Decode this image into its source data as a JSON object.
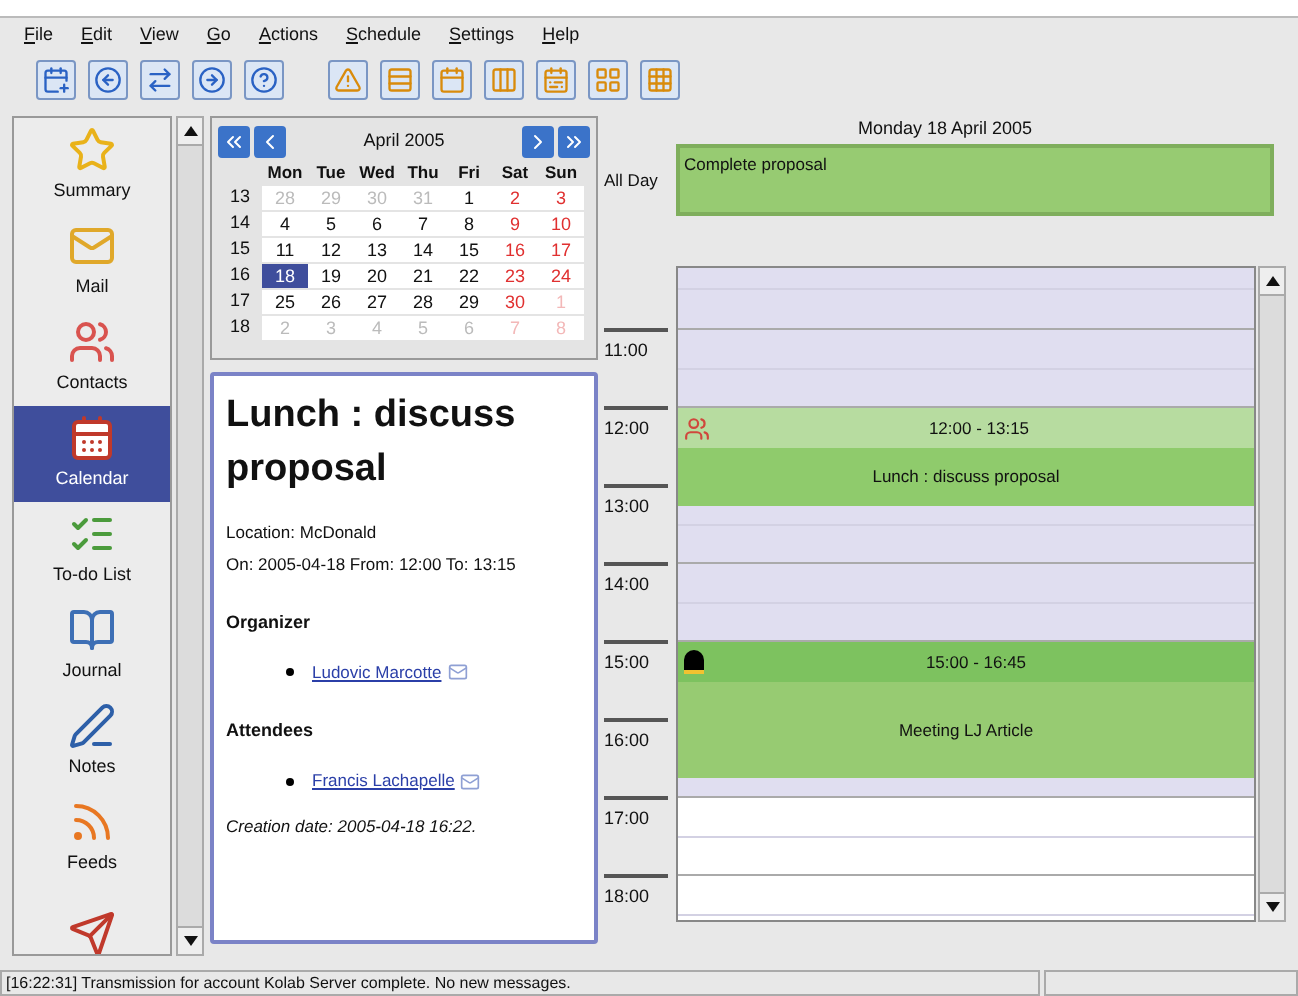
{
  "menu": [
    "File",
    "Edit",
    "View",
    "Go",
    "Actions",
    "Schedule",
    "Settings",
    "Help"
  ],
  "sidebar": {
    "items": [
      {
        "label": "Summary",
        "selected": false
      },
      {
        "label": "Mail",
        "selected": false
      },
      {
        "label": "Contacts",
        "selected": false
      },
      {
        "label": "Calendar",
        "selected": true
      },
      {
        "label": "To-do List",
        "selected": false
      },
      {
        "label": "Journal",
        "selected": false
      },
      {
        "label": "Notes",
        "selected": false
      },
      {
        "label": "Feeds",
        "selected": false
      },
      {
        "selected": false
      }
    ]
  },
  "mini_calendar": {
    "month": "April 2005",
    "weekdays": [
      "Mon",
      "Tue",
      "Wed",
      "Thu",
      "Fri",
      "Sat",
      "Sun"
    ],
    "weeks": [
      {
        "number": "13",
        "days": [
          {
            "day": "28",
            "other_month": true,
            "selected": false
          },
          {
            "day": "29",
            "other_month": true,
            "selected": false
          },
          {
            "day": "30",
            "other_month": true,
            "selected": false
          },
          {
            "day": "31",
            "other_month": true,
            "selected": false
          },
          {
            "day": "1",
            "other_month": false,
            "selected": false
          },
          {
            "day": "2",
            "other_month": false,
            "selected": false
          },
          {
            "day": "3",
            "other_month": false,
            "selected": false
          }
        ]
      },
      {
        "number": "14",
        "days": [
          {
            "day": "4",
            "other_month": false,
            "selected": false
          },
          {
            "day": "5",
            "other_month": false,
            "selected": false
          },
          {
            "day": "6",
            "other_month": false,
            "selected": false
          },
          {
            "day": "7",
            "other_month": false,
            "selected": false
          },
          {
            "day": "8",
            "other_month": false,
            "selected": false
          },
          {
            "day": "9",
            "other_month": false,
            "selected": false
          },
          {
            "day": "10",
            "other_month": false,
            "selected": false
          }
        ]
      },
      {
        "number": "15",
        "days": [
          {
            "day": "11",
            "other_month": false,
            "selected": false
          },
          {
            "day": "12",
            "other_month": false,
            "selected": false
          },
          {
            "day": "13",
            "other_month": false,
            "selected": false
          },
          {
            "day": "14",
            "other_month": false,
            "selected": false
          },
          {
            "day": "15",
            "other_month": false,
            "selected": false
          },
          {
            "day": "16",
            "other_month": false,
            "selected": false
          },
          {
            "day": "17",
            "other_month": false,
            "selected": false
          }
        ]
      },
      {
        "number": "16",
        "days": [
          {
            "day": "18",
            "other_month": false,
            "selected": true
          },
          {
            "day": "19",
            "other_month": false,
            "selected": false
          },
          {
            "day": "20",
            "other_month": false,
            "selected": false
          },
          {
            "day": "21",
            "other_month": false,
            "selected": false
          },
          {
            "day": "22",
            "other_month": false,
            "selected": false
          },
          {
            "day": "23",
            "other_month": false,
            "selected": false
          },
          {
            "day": "24",
            "other_month": false,
            "selected": false
          }
        ]
      },
      {
        "number": "17",
        "days": [
          {
            "day": "25",
            "other_month": false,
            "selected": false
          },
          {
            "day": "26",
            "other_month": false,
            "selected": false
          },
          {
            "day": "27",
            "other_month": false,
            "selected": false
          },
          {
            "day": "28",
            "other_month": false,
            "selected": false
          },
          {
            "day": "29",
            "other_month": false,
            "selected": false
          },
          {
            "day": "30",
            "other_month": false,
            "selected": false
          },
          {
            "day": "1",
            "other_month": true,
            "selected": false
          }
        ]
      },
      {
        "number": "18",
        "days": [
          {
            "day": "2",
            "other_month": true,
            "selected": false
          },
          {
            "day": "3",
            "other_month": true,
            "selected": false
          },
          {
            "day": "4",
            "other_month": true,
            "selected": false
          },
          {
            "day": "5",
            "other_month": true,
            "selected": false
          },
          {
            "day": "6",
            "other_month": true,
            "selected": false
          },
          {
            "day": "7",
            "other_month": true,
            "selected": false
          },
          {
            "day": "8",
            "other_month": true,
            "selected": false
          }
        ]
      }
    ]
  },
  "event_details": {
    "title": "Lunch : discuss proposal",
    "location": "Location: McDonald",
    "when": "On: 2005-04-18 From: 12:00 To: 13:15",
    "organizer_heading": "Organizer",
    "organizer": "Ludovic Marcotte",
    "attendees_heading": "Attendees",
    "attendees": [
      "Francis Lachapelle"
    ],
    "creation": "Creation date: 2005-04-18 16:22."
  },
  "day_view": {
    "date": "Monday 18 April 2005",
    "all_day_label": "All Day",
    "all_day_event": "Complete proposal",
    "hours": [
      {
        "label": "11:00",
        "working": true
      },
      {
        "label": "12:00"
      },
      {
        "label": "13:00",
        "working": true
      },
      {
        "label": "14:00",
        "working": true
      },
      {
        "label": "15:00"
      },
      {
        "label": "16:00",
        "working": true
      },
      {
        "label": "17:00",
        "working": false
      },
      {
        "label": "18:00",
        "working": false
      }
    ],
    "events": [
      {
        "kind": "group",
        "time": "12:00 - 13:15",
        "title": "Lunch : discuss proposal"
      },
      {
        "kind": "personal",
        "time": "15:00 - 16:45",
        "title": "Meeting LJ Article"
      }
    ]
  },
  "status_bar": "[16:22:31] Transmission for account Kolab Server complete. No new messages."
}
